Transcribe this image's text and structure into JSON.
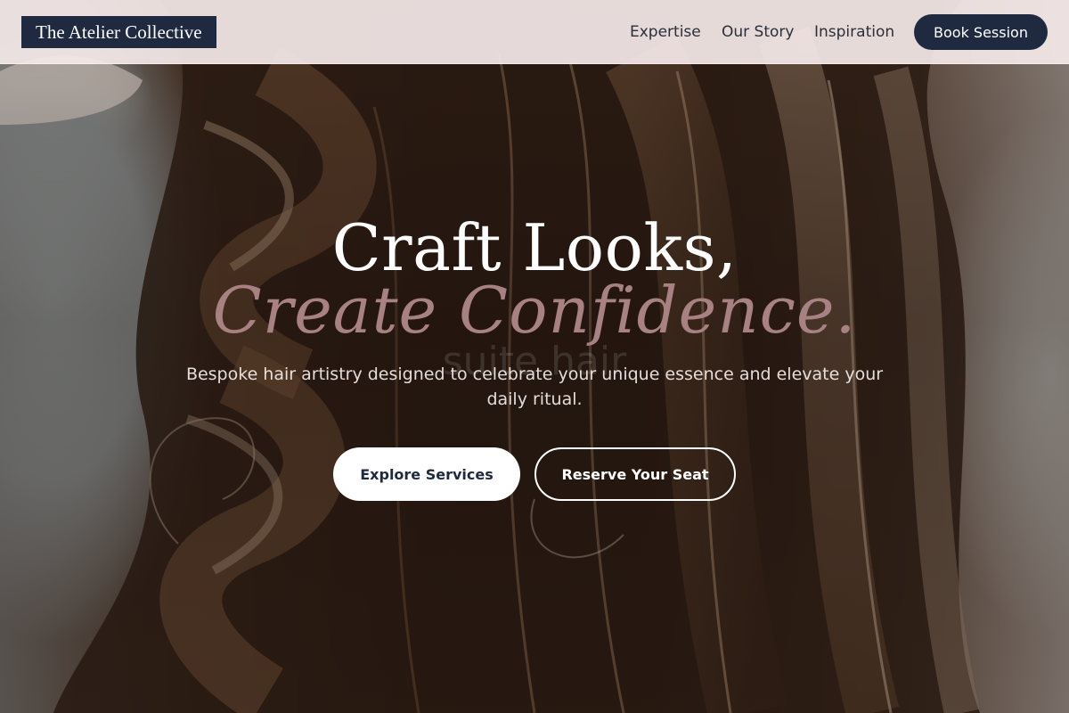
{
  "brand": {
    "name": "The Atelier Collective"
  },
  "nav": {
    "items": [
      {
        "label": "Expertise"
      },
      {
        "label": "Our Story"
      },
      {
        "label": "Inspiration"
      }
    ],
    "cta_label": "Book Session"
  },
  "hero": {
    "headline_line1": "Craft Looks,",
    "headline_line2": "Create Confidence.",
    "background_watermark": "suite hair",
    "subtitle": "Bespoke hair artistry designed to celebrate your unique essence and elevate your daily ritual.",
    "primary_button": "Explore Services",
    "secondary_button": "Reserve Your Seat"
  },
  "colors": {
    "navy": "#1f2a40",
    "header_bg": "#f4e8e8",
    "accent_rose": "#a88283",
    "white": "#ffffff"
  }
}
